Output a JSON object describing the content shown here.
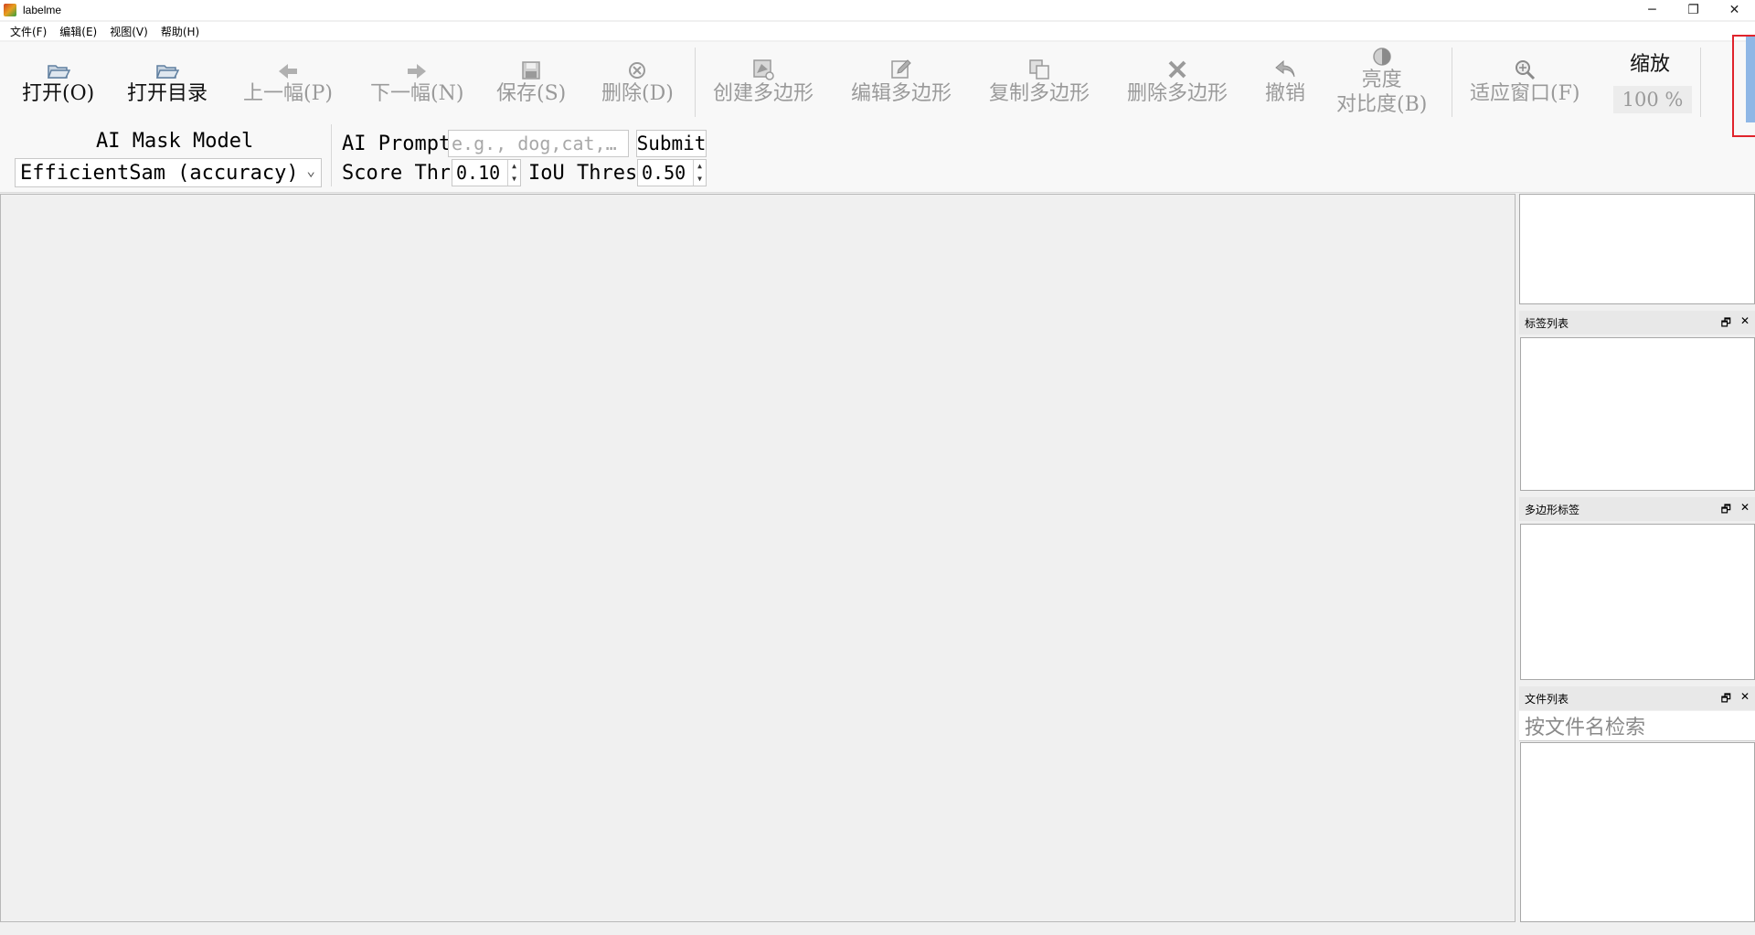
{
  "window": {
    "title": "labelme",
    "minimize_glyph": "─",
    "restore_glyph": "❐",
    "close_glyph": "✕"
  },
  "menu": {
    "items": [
      "文件(F)",
      "编辑(E)",
      "视图(V)",
      "帮助(H)"
    ]
  },
  "toolbar": {
    "open": {
      "label": "打开(O)",
      "icon": "open-folder-icon"
    },
    "open_dir": {
      "label": "打开目录",
      "icon": "open-folder-icon"
    },
    "prev": {
      "label": "上一幅(P)",
      "icon": "arrow-left-icon"
    },
    "next": {
      "label": "下一幅(N)",
      "icon": "arrow-right-icon"
    },
    "save": {
      "label": "保存(S)",
      "icon": "save-icon"
    },
    "delete": {
      "label": "删除(D)",
      "icon": "delete-circle-icon"
    },
    "create_polygon": {
      "label": "创建多边形",
      "icon": "create-polygon-icon"
    },
    "edit_polygon": {
      "label": "编辑多边形",
      "icon": "edit-icon"
    },
    "copy_polygon": {
      "label": "复制多边形",
      "icon": "copy-icon"
    },
    "delete_polygon": {
      "label": "删除多边形",
      "icon": "cross-icon"
    },
    "undo": {
      "label": "撤销",
      "icon": "undo-icon"
    },
    "brightness_line1": "亮度",
    "brightness_line2": "对比度(B)",
    "fit_window": {
      "label": "适应窗口(F)",
      "icon": "zoom-icon"
    },
    "zoom_label": "缩放",
    "zoom_value": "100 %"
  },
  "ai": {
    "mask_model_title": "AI Mask Model",
    "mask_model_value": "EfficientSam (accuracy)",
    "prompt_label": "AI Prompt",
    "prompt_placeholder": "e.g., dog,cat,…",
    "submit_label": "Submit",
    "score_label": "Score Threshold",
    "score_value": "0.10",
    "iou_label": "IoU Threshold",
    "iou_value": "0.50"
  },
  "docks": {
    "label_list_title": "标签列表",
    "polygon_labels_title": "多边形标签",
    "file_list_title": "文件列表",
    "file_search_placeholder": "按文件名检索",
    "float_glyph": "🗗",
    "close_glyph": "✕"
  },
  "colors": {
    "highlight": "#e0242c",
    "disabled_text": "#9a9a9a"
  }
}
